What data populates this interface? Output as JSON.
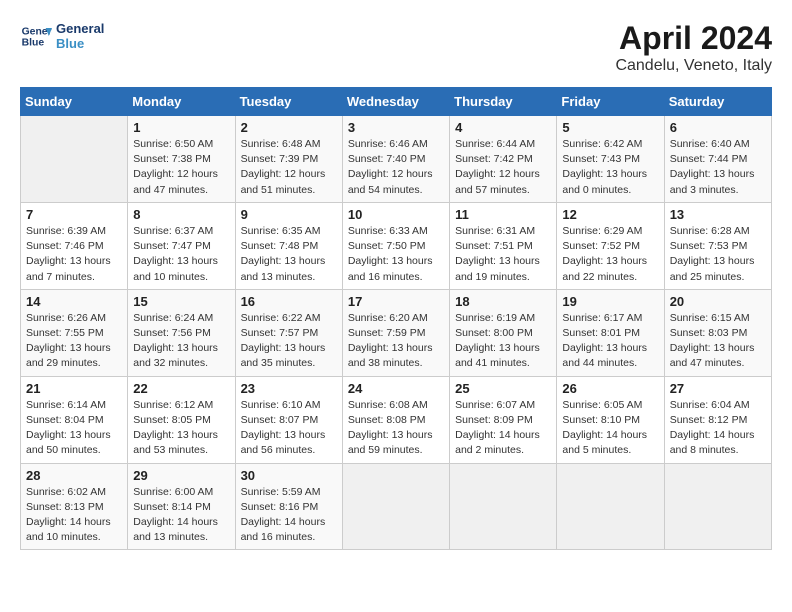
{
  "header": {
    "logo_line1": "General",
    "logo_line2": "Blue",
    "title": "April 2024",
    "subtitle": "Candelu, Veneto, Italy"
  },
  "calendar": {
    "days_of_week": [
      "Sunday",
      "Monday",
      "Tuesday",
      "Wednesday",
      "Thursday",
      "Friday",
      "Saturday"
    ],
    "weeks": [
      [
        {
          "day": "",
          "info": ""
        },
        {
          "day": "1",
          "info": "Sunrise: 6:50 AM\nSunset: 7:38 PM\nDaylight: 12 hours\nand 47 minutes."
        },
        {
          "day": "2",
          "info": "Sunrise: 6:48 AM\nSunset: 7:39 PM\nDaylight: 12 hours\nand 51 minutes."
        },
        {
          "day": "3",
          "info": "Sunrise: 6:46 AM\nSunset: 7:40 PM\nDaylight: 12 hours\nand 54 minutes."
        },
        {
          "day": "4",
          "info": "Sunrise: 6:44 AM\nSunset: 7:42 PM\nDaylight: 12 hours\nand 57 minutes."
        },
        {
          "day": "5",
          "info": "Sunrise: 6:42 AM\nSunset: 7:43 PM\nDaylight: 13 hours\nand 0 minutes."
        },
        {
          "day": "6",
          "info": "Sunrise: 6:40 AM\nSunset: 7:44 PM\nDaylight: 13 hours\nand 3 minutes."
        }
      ],
      [
        {
          "day": "7",
          "info": "Sunrise: 6:39 AM\nSunset: 7:46 PM\nDaylight: 13 hours\nand 7 minutes."
        },
        {
          "day": "8",
          "info": "Sunrise: 6:37 AM\nSunset: 7:47 PM\nDaylight: 13 hours\nand 10 minutes."
        },
        {
          "day": "9",
          "info": "Sunrise: 6:35 AM\nSunset: 7:48 PM\nDaylight: 13 hours\nand 13 minutes."
        },
        {
          "day": "10",
          "info": "Sunrise: 6:33 AM\nSunset: 7:50 PM\nDaylight: 13 hours\nand 16 minutes."
        },
        {
          "day": "11",
          "info": "Sunrise: 6:31 AM\nSunset: 7:51 PM\nDaylight: 13 hours\nand 19 minutes."
        },
        {
          "day": "12",
          "info": "Sunrise: 6:29 AM\nSunset: 7:52 PM\nDaylight: 13 hours\nand 22 minutes."
        },
        {
          "day": "13",
          "info": "Sunrise: 6:28 AM\nSunset: 7:53 PM\nDaylight: 13 hours\nand 25 minutes."
        }
      ],
      [
        {
          "day": "14",
          "info": "Sunrise: 6:26 AM\nSunset: 7:55 PM\nDaylight: 13 hours\nand 29 minutes."
        },
        {
          "day": "15",
          "info": "Sunrise: 6:24 AM\nSunset: 7:56 PM\nDaylight: 13 hours\nand 32 minutes."
        },
        {
          "day": "16",
          "info": "Sunrise: 6:22 AM\nSunset: 7:57 PM\nDaylight: 13 hours\nand 35 minutes."
        },
        {
          "day": "17",
          "info": "Sunrise: 6:20 AM\nSunset: 7:59 PM\nDaylight: 13 hours\nand 38 minutes."
        },
        {
          "day": "18",
          "info": "Sunrise: 6:19 AM\nSunset: 8:00 PM\nDaylight: 13 hours\nand 41 minutes."
        },
        {
          "day": "19",
          "info": "Sunrise: 6:17 AM\nSunset: 8:01 PM\nDaylight: 13 hours\nand 44 minutes."
        },
        {
          "day": "20",
          "info": "Sunrise: 6:15 AM\nSunset: 8:03 PM\nDaylight: 13 hours\nand 47 minutes."
        }
      ],
      [
        {
          "day": "21",
          "info": "Sunrise: 6:14 AM\nSunset: 8:04 PM\nDaylight: 13 hours\nand 50 minutes."
        },
        {
          "day": "22",
          "info": "Sunrise: 6:12 AM\nSunset: 8:05 PM\nDaylight: 13 hours\nand 53 minutes."
        },
        {
          "day": "23",
          "info": "Sunrise: 6:10 AM\nSunset: 8:07 PM\nDaylight: 13 hours\nand 56 minutes."
        },
        {
          "day": "24",
          "info": "Sunrise: 6:08 AM\nSunset: 8:08 PM\nDaylight: 13 hours\nand 59 minutes."
        },
        {
          "day": "25",
          "info": "Sunrise: 6:07 AM\nSunset: 8:09 PM\nDaylight: 14 hours\nand 2 minutes."
        },
        {
          "day": "26",
          "info": "Sunrise: 6:05 AM\nSunset: 8:10 PM\nDaylight: 14 hours\nand 5 minutes."
        },
        {
          "day": "27",
          "info": "Sunrise: 6:04 AM\nSunset: 8:12 PM\nDaylight: 14 hours\nand 8 minutes."
        }
      ],
      [
        {
          "day": "28",
          "info": "Sunrise: 6:02 AM\nSunset: 8:13 PM\nDaylight: 14 hours\nand 10 minutes."
        },
        {
          "day": "29",
          "info": "Sunrise: 6:00 AM\nSunset: 8:14 PM\nDaylight: 14 hours\nand 13 minutes."
        },
        {
          "day": "30",
          "info": "Sunrise: 5:59 AM\nSunset: 8:16 PM\nDaylight: 14 hours\nand 16 minutes."
        },
        {
          "day": "",
          "info": ""
        },
        {
          "day": "",
          "info": ""
        },
        {
          "day": "",
          "info": ""
        },
        {
          "day": "",
          "info": ""
        }
      ]
    ]
  }
}
